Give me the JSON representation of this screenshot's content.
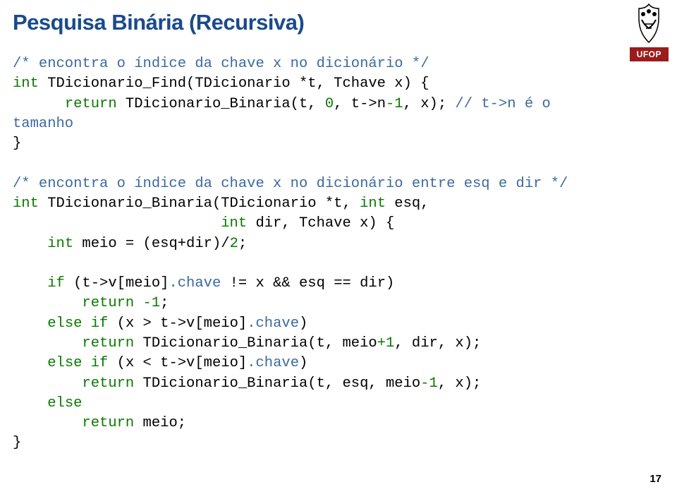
{
  "title": "Pesquisa Binária (Recursiva)",
  "logo_label": "UFOP",
  "page_number": "17",
  "code": {
    "c1": "/* encontra o índice da chave x no dicionário */",
    "l2_kw1": "int",
    "l2_rest": " TDicionario_Find(TDicionario *t, Tchave x) {",
    "l3_pad": "      ",
    "l3_kw": "return",
    "l3_a": " TDicionario_Binaria(t, ",
    "l3_n0": "0",
    "l3_b": ", t->n",
    "l3_m1": "-1",
    "l3_c": ", x); ",
    "l3_cm": "// t->n é o",
    "l4": "tamanho",
    "l5": "}",
    "c2": "/* encontra o índice da chave x no dicionário entre esq e dir */",
    "l8_kw": "int",
    "l8_a": " TDicionario_Binaria(TDicionario *t, ",
    "l8_kw2": "int",
    "l8_b": " esq,",
    "l9_pad": "                        ",
    "l9_kw": "int",
    "l9_a": " dir, Tchave x) {",
    "l10_pad": "    ",
    "l10_kw": "int",
    "l10_a": " meio = (esq+dir)/",
    "l10_n": "2",
    "l10_b": ";",
    "l12_pad": "    ",
    "l12_kw": "if",
    "l12_a": " (t->v[meio]",
    "l12_m": ".chave",
    "l12_b": " != x && esq == dir)",
    "l13_pad": "        ",
    "l13_kw": "return",
    "l13_n": " -1",
    "l13_b": ";",
    "l14_pad": "    ",
    "l14_kw": "else if",
    "l14_a": " (x > t->v[meio]",
    "l14_m": ".chave",
    "l14_b": ")",
    "l15_pad": "        ",
    "l15_kw": "return",
    "l15_a": " TDicionario_Binaria(t, meio",
    "l15_n": "+1",
    "l15_b": ", dir, x);",
    "l16_pad": "    ",
    "l16_kw": "else if",
    "l16_a": " (x < t->v[meio]",
    "l16_m": ".chave",
    "l16_b": ")",
    "l17_pad": "        ",
    "l17_kw": "return",
    "l17_a": " TDicionario_Binaria(t, esq, meio",
    "l17_n": "-1",
    "l17_b": ", x);",
    "l18_pad": "    ",
    "l18_kw": "else",
    "l19_pad": "        ",
    "l19_kw": "return",
    "l19_a": " meio;",
    "l20": "}"
  }
}
